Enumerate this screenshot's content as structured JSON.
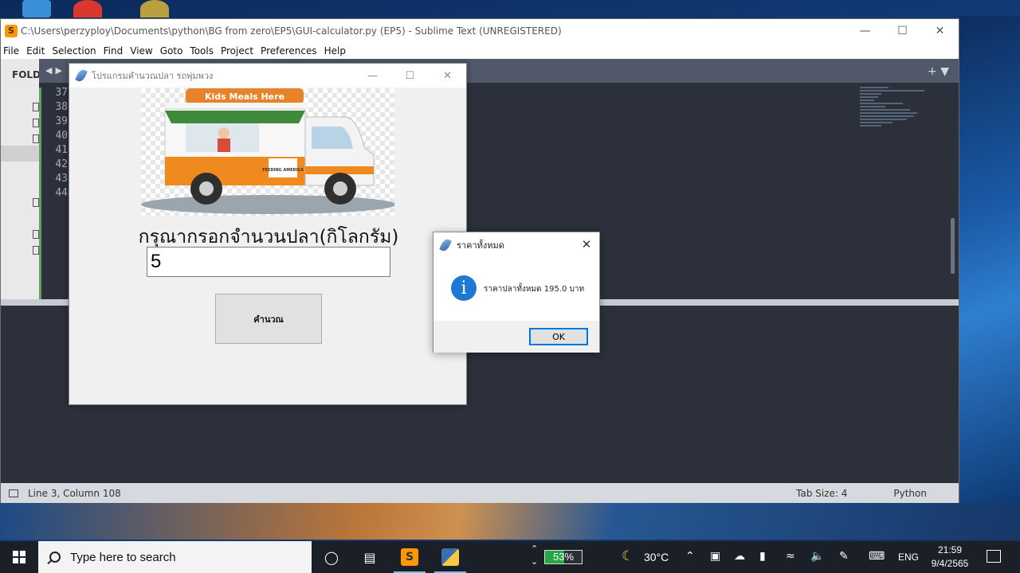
{
  "sublime": {
    "title": "C:\\Users\\perzyploy\\Documents\\python\\BG from zero\\EP5\\GUI-calculator.py (EP5) - Sublime Text (UNREGISTERED)",
    "menu": [
      "File",
      "Edit",
      "Selection",
      "Find",
      "View",
      "Goto",
      "Tools",
      "Project",
      "Preferences",
      "Help"
    ],
    "sidebar_label": "FOLD",
    "line_numbers": [
      "37",
      "38",
      "39",
      "40",
      "41",
      "42",
      "43",
      "44"
    ],
    "status_position": "Line 3, Column 108",
    "tab_size": "Tab Size: 4",
    "syntax": "Python"
  },
  "tk_window": {
    "title": "โปรแกรมคำนวณปลา รถพุ่มพวง",
    "image_caption": "Kids Meals Here",
    "truck_sign": "FEEDING AMERICA",
    "prompt_label": "กรุณากรอกจำนวนปลา(กิโลกรัม)",
    "entry_value": "5",
    "button_label": "คำนวณ"
  },
  "message_box": {
    "title": "ราคาทั้งหมด",
    "message": "ราคาปลาทั้งหมด 195.0 บาท",
    "ok_label": "OK"
  },
  "taskbar": {
    "search_placeholder": "Type here to search",
    "battery": "53%",
    "battery_level": 0.53,
    "temperature": "30°C",
    "language": "ENG",
    "time": "21:59",
    "date": "9/4/2565"
  },
  "colors": {
    "accent": "#0078d7",
    "info_icon": "#1f78d1",
    "editor_bg": "#2b303b",
    "sublime_orange": "#ff9800"
  }
}
